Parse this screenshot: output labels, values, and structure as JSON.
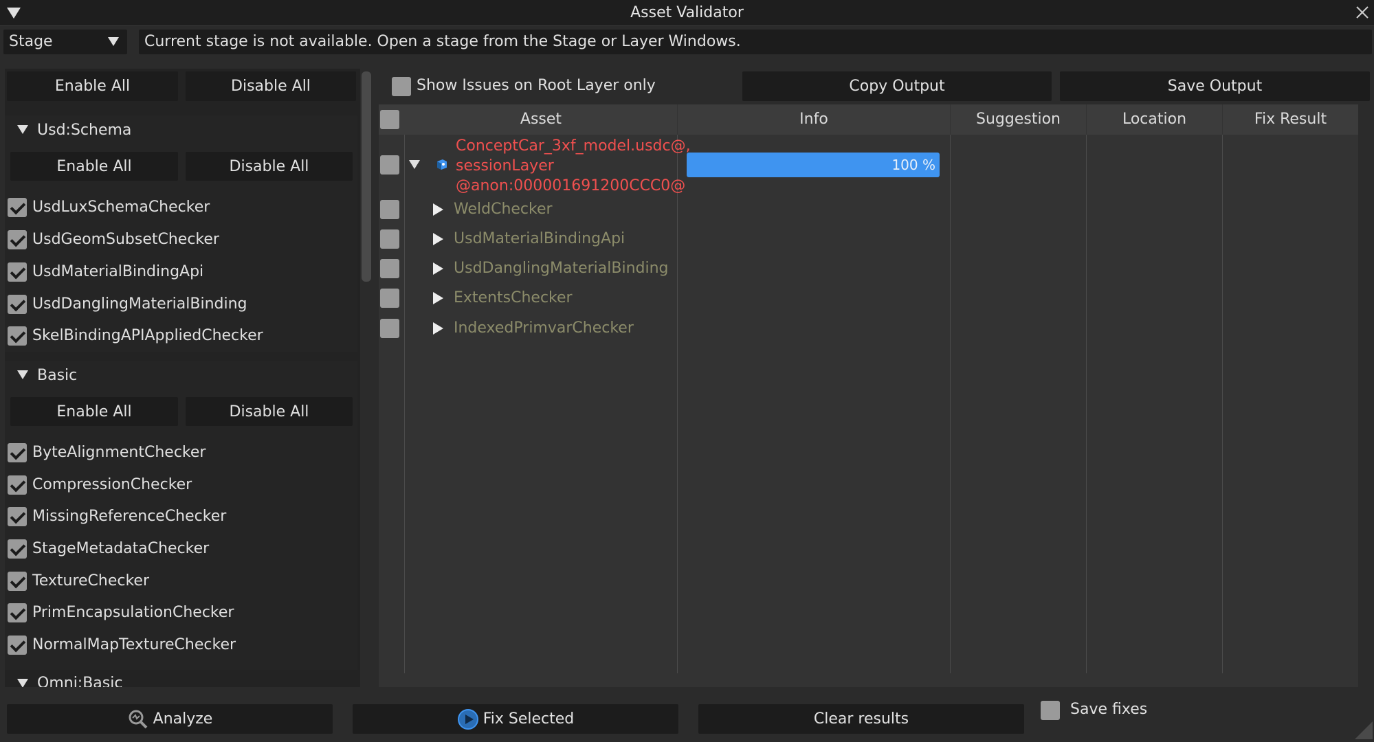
{
  "window": {
    "title": "Asset Validator"
  },
  "stage_select": {
    "value": "Stage"
  },
  "status_message": "Current stage is not available. Open a stage from the Stage or Layer Windows.",
  "left": {
    "enable_all": "Enable All",
    "disable_all": "Disable All",
    "groups": [
      {
        "name": "Usd:Schema",
        "enable_all": "Enable All",
        "disable_all": "Disable All",
        "items": [
          "UsdLuxSchemaChecker",
          "UsdGeomSubsetChecker",
          "UsdMaterialBindingApi",
          "UsdDanglingMaterialBinding",
          "SkelBindingAPIAppliedChecker"
        ]
      },
      {
        "name": "Basic",
        "enable_all": "Enable All",
        "disable_all": "Disable All",
        "items": [
          "ByteAlignmentChecker",
          "CompressionChecker",
          "MissingReferenceChecker",
          "StageMetadataChecker",
          "TextureChecker",
          "PrimEncapsulationChecker",
          "NormalMapTextureChecker"
        ]
      },
      {
        "name": "Omni:Basic"
      }
    ]
  },
  "right": {
    "show_issues_label": "Show Issues on Root Layer only",
    "copy_output": "Copy Output",
    "save_output": "Save Output",
    "columns": [
      "Asset",
      "Info",
      "Suggestion",
      "Location",
      "Fix Result"
    ],
    "root": {
      "lines": [
        "ConceptCar_3xf_model.usdc@,",
        "sessionLayer",
        "@anon:000001691200CCC0@"
      ],
      "progress_label": "100 %",
      "progress": 1.0
    },
    "children": [
      "WeldChecker",
      "UsdMaterialBindingApi",
      "UsdDanglingMaterialBinding",
      "ExtentsChecker",
      "IndexedPrimvarChecker"
    ]
  },
  "bottom": {
    "analyze": "Analyze",
    "fix_selected": "Fix Selected",
    "clear_results": "Clear results",
    "save_fixes": "Save fixes"
  },
  "colors": {
    "accent": "#3f94f0",
    "error_text": "#f0504f",
    "tree_text": "#8c8c6a"
  },
  "icons": [
    "collapse-icon",
    "close-icon",
    "dropdown-arrow-icon",
    "search-analyze-icon",
    "play-icon",
    "stage-icon"
  ]
}
